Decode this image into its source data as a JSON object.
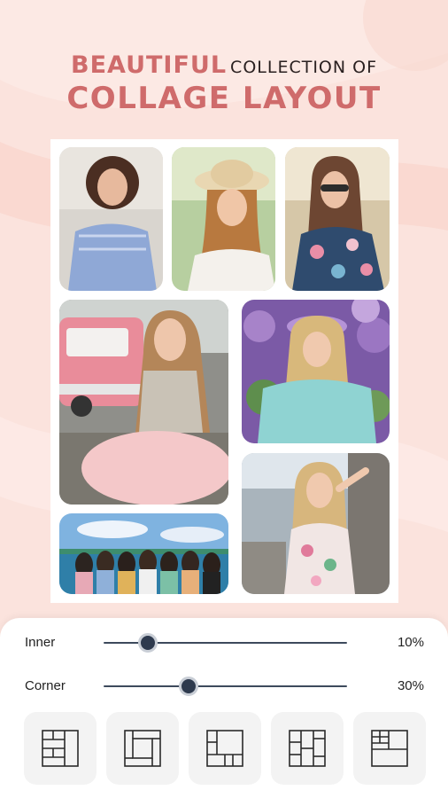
{
  "headline": {
    "accent_word": "BEAUTIFUL",
    "rest_line1": "COLLECTION OF",
    "line2": "COLLAGE LAYOUT"
  },
  "colors": {
    "accent": "#cf6b6b",
    "background": "#fbe3dd",
    "slider": "#2e3a4e"
  },
  "sliders": [
    {
      "label": "Inner",
      "value": "10%",
      "fraction": 0.1
    },
    {
      "label": "Corner",
      "value": "30%",
      "fraction": 0.3
    }
  ],
  "layouts": [
    {
      "icon": "layout-grid-1-icon"
    },
    {
      "icon": "layout-grid-2-icon"
    },
    {
      "icon": "layout-grid-3-icon"
    },
    {
      "icon": "layout-grid-4-icon"
    },
    {
      "icon": "layout-grid-5-icon"
    }
  ],
  "photos": [
    {
      "name": "photo-curly-girl-blue-top"
    },
    {
      "name": "photo-girl-straw-hat"
    },
    {
      "name": "photo-girl-sunglasses-floral"
    },
    {
      "name": "photo-girl-pink-car"
    },
    {
      "name": "photo-girl-lilac-flowers"
    },
    {
      "name": "photo-girl-posing-street"
    },
    {
      "name": "photo-group-of-girls-sea"
    }
  ]
}
